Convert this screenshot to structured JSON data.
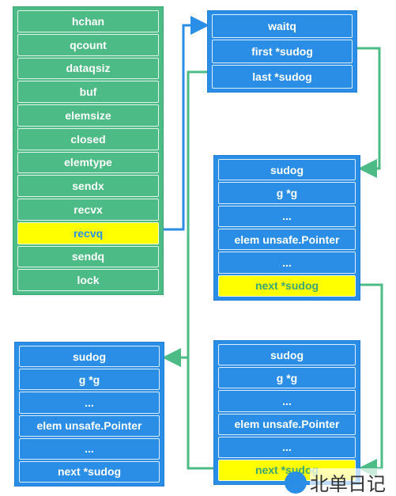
{
  "hchan": {
    "fields": [
      "hchan",
      "qcount",
      "dataqsiz",
      "buf",
      "elemsize",
      "closed",
      "elemtype",
      "sendx",
      "recvx",
      "recvq",
      "sendq",
      "lock"
    ],
    "highlight": "recvq"
  },
  "waitq": {
    "fields": [
      "waitq",
      "first *sudog",
      "last *sudog"
    ]
  },
  "sudog1": {
    "fields": [
      "sudog",
      "g *g",
      "...",
      "elem unsafe.Pointer",
      "...",
      "next *sudog"
    ]
  },
  "sudog2": {
    "fields": [
      "sudog",
      "g *g",
      "...",
      "elem unsafe.Pointer",
      "...",
      "next *sudog"
    ]
  },
  "sudog3": {
    "fields": [
      "sudog",
      "g *g",
      "...",
      "elem unsafe.Pointer",
      "...",
      "next *sudog"
    ]
  },
  "colors": {
    "green": "#4dbb85",
    "blue": "#2b8ee6",
    "highlight": "#ffff00"
  },
  "watermark": {
    "text": "北单日记",
    "icon": "logo-icon"
  }
}
